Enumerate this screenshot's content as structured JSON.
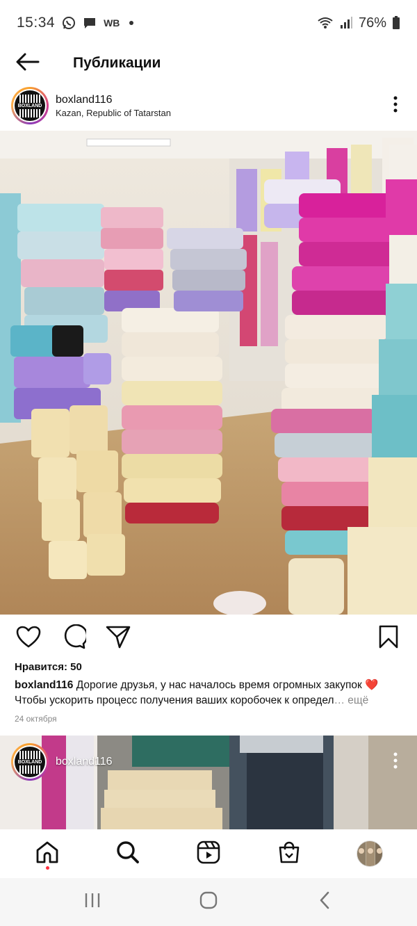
{
  "status_bar": {
    "time": "15:34",
    "wb": "WB",
    "battery": "76%",
    "icons": [
      "whatsapp-icon",
      "message-icon",
      "wifi-icon",
      "signal-icon",
      "battery-icon"
    ]
  },
  "header": {
    "title": "Публикации",
    "back_icon": "arrow-left-icon"
  },
  "post": {
    "username": "boxland116",
    "location": "Kazan, Republic of Tatarstan",
    "avatar_text": "BOXLAND",
    "likes": "Нравится: 50",
    "caption_user": "boxland116",
    "caption_line1": "Дорогие друзья, у нас началось время огромных закупок",
    "caption_emoji": "❤️",
    "caption_line2": "Чтобы ускорить процесс получения ваших коробочек к определ",
    "caption_more": "… ещё",
    "date": "24 октября",
    "actions": [
      "heart-icon",
      "comment-icon",
      "share-icon",
      "bookmark-icon"
    ]
  },
  "next_post": {
    "username": "boxland116",
    "avatar_text": "BOXLAND"
  },
  "bottom_nav": {
    "items": [
      "home-icon",
      "search-icon",
      "reels-icon",
      "shop-icon",
      "profile-avatar"
    ]
  },
  "system_nav": {
    "items": [
      "recents-icon",
      "home-circle-icon",
      "back-chevron-icon"
    ]
  },
  "colors": {
    "notification_dot": "#ff3040",
    "heart_emoji": "#e0245e",
    "muted_text": "#888888"
  }
}
